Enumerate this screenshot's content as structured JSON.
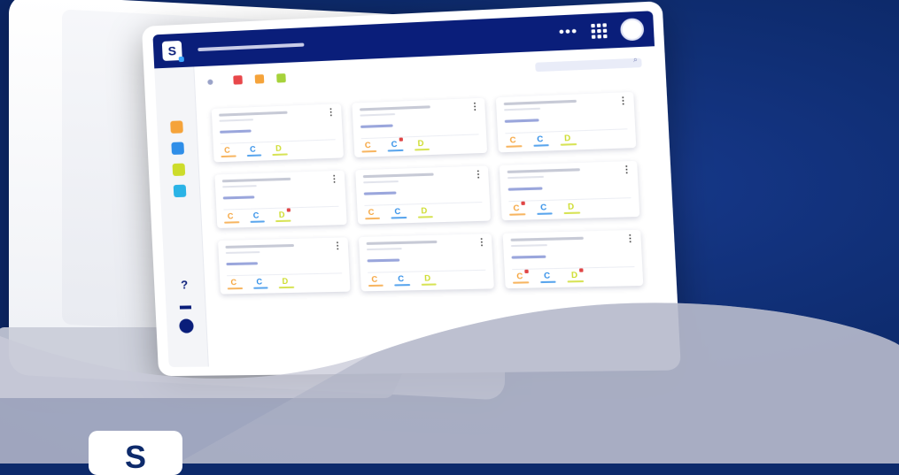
{
  "app": {
    "logo_letter": "S",
    "bottom_logo_letter": "S"
  },
  "topbar": {
    "more_icon": "more-horizontal-icon",
    "apps_icon": "grid-icon"
  },
  "sidebar": {
    "items": [
      {
        "name": "home-icon",
        "color": "#9fc3f0"
      },
      {
        "name": "module-orange",
        "color": "#f5a33a"
      },
      {
        "name": "module-blue",
        "color": "#2f8ee8"
      },
      {
        "name": "module-lime",
        "color": "#cddc2b"
      },
      {
        "name": "module-cyan",
        "color": "#2ab3e6"
      }
    ],
    "help_label": "?",
    "info_label": "i"
  },
  "filters": {
    "colors": [
      "#e8474a",
      "#f5a33a",
      "#a6d23a"
    ]
  },
  "cards": [
    {
      "badges": [
        {
          "label": "C",
          "color": "#f5a33a"
        },
        {
          "label": "C",
          "color": "#2f8ee8"
        },
        {
          "label": "D",
          "color": "#cddc2b"
        }
      ]
    },
    {
      "badges": [
        {
          "label": "C",
          "color": "#f5a33a"
        },
        {
          "label": "C",
          "color": "#2f8ee8",
          "flag": true
        },
        {
          "label": "D",
          "color": "#cddc2b"
        }
      ]
    },
    {
      "badges": [
        {
          "label": "C",
          "color": "#f5a33a"
        },
        {
          "label": "C",
          "color": "#2f8ee8"
        },
        {
          "label": "D",
          "color": "#cddc2b"
        }
      ]
    },
    {
      "badges": [
        {
          "label": "C",
          "color": "#f5a33a"
        },
        {
          "label": "C",
          "color": "#2f8ee8"
        },
        {
          "label": "D",
          "color": "#cddc2b",
          "flag": true
        }
      ]
    },
    {
      "badges": [
        {
          "label": "C",
          "color": "#f5a33a"
        },
        {
          "label": "C",
          "color": "#2f8ee8"
        },
        {
          "label": "D",
          "color": "#cddc2b"
        }
      ]
    },
    {
      "badges": [
        {
          "label": "C",
          "color": "#f5a33a",
          "flag": true
        },
        {
          "label": "C",
          "color": "#2f8ee8"
        },
        {
          "label": "D",
          "color": "#cddc2b"
        }
      ]
    },
    {
      "badges": [
        {
          "label": "C",
          "color": "#f5a33a"
        },
        {
          "label": "C",
          "color": "#2f8ee8"
        },
        {
          "label": "D",
          "color": "#cddc2b"
        }
      ]
    },
    {
      "badges": [
        {
          "label": "C",
          "color": "#f5a33a"
        },
        {
          "label": "C",
          "color": "#2f8ee8"
        },
        {
          "label": "D",
          "color": "#cddc2b"
        }
      ]
    },
    {
      "badges": [
        {
          "label": "C",
          "color": "#f5a33a",
          "flag": true
        },
        {
          "label": "C",
          "color": "#2f8ee8"
        },
        {
          "label": "D",
          "color": "#cddc2b",
          "flag": true
        }
      ]
    }
  ]
}
